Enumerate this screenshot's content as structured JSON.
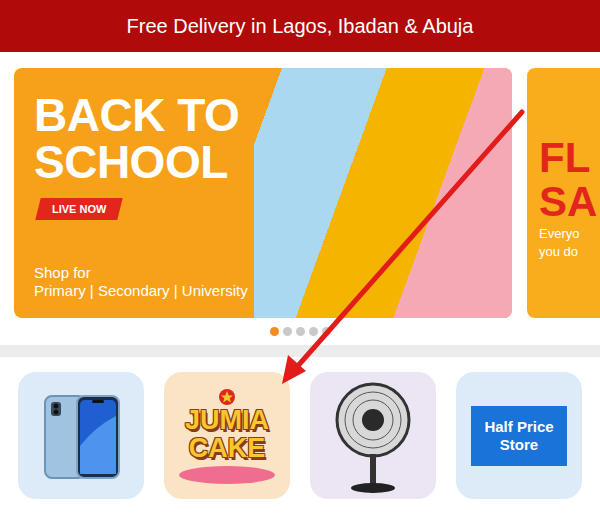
{
  "promo_bar": {
    "text": "Free Delivery in Lagos, Ibadan & Abuja"
  },
  "carousel": {
    "slides": [
      {
        "title_lines": [
          "BACK TO",
          "SCHOOL"
        ],
        "badge": "LIVE NOW",
        "subtitle": "Shop for",
        "categories": "Primary | Secondary | University"
      },
      {
        "title_lines": [
          "FL",
          "SA"
        ],
        "text_lines": [
          "Everyo",
          "you do"
        ]
      }
    ],
    "dots": [
      {
        "selected": true
      },
      {
        "selected": false
      },
      {
        "selected": false
      },
      {
        "selected": false
      },
      {
        "selected": false
      }
    ]
  },
  "shortcuts": [
    {
      "kind": "phone"
    },
    {
      "kind": "cake",
      "label_lines": [
        "JUMIA",
        "CAKE"
      ]
    },
    {
      "kind": "fan"
    },
    {
      "kind": "text",
      "label": "Half Price Store"
    }
  ]
}
